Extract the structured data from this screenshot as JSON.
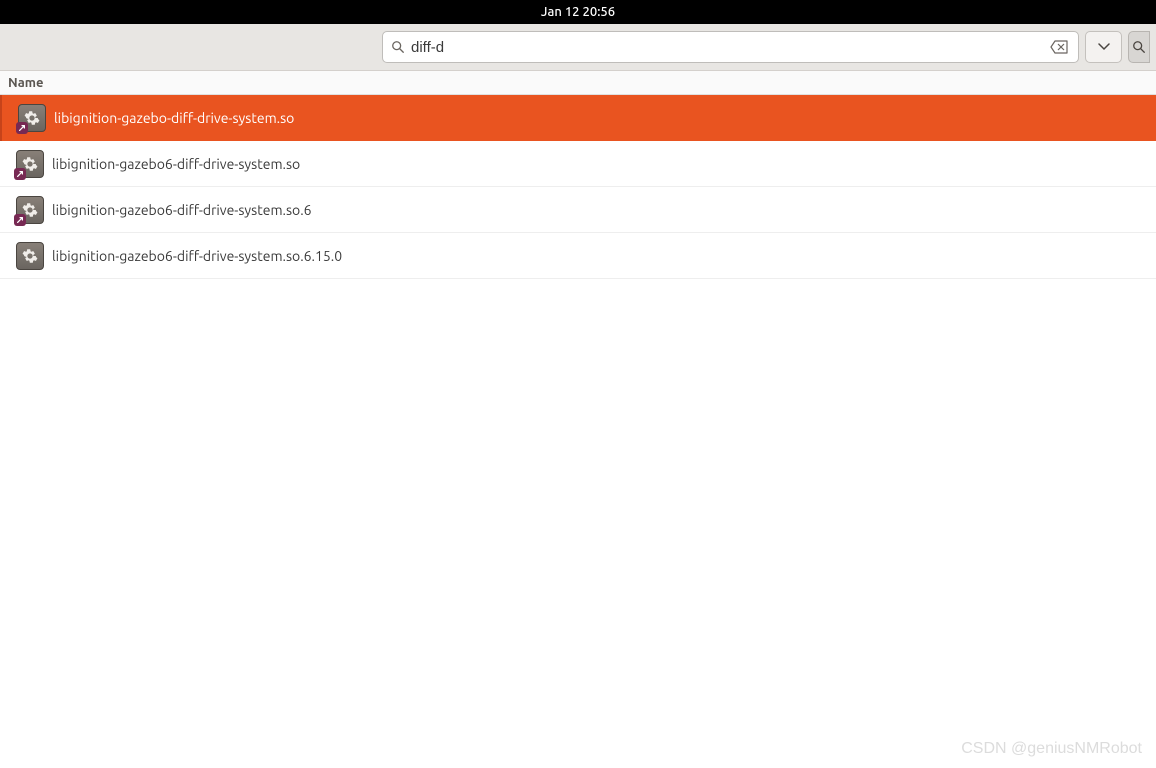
{
  "topbar": {
    "datetime": "Jan 12  20:56"
  },
  "search": {
    "value": "diff-d",
    "placeholder": ""
  },
  "columns": {
    "name": "Name"
  },
  "files": [
    {
      "name": "libignition-gazebo-diff-drive-system.so",
      "selected": true,
      "symlink": true
    },
    {
      "name": "libignition-gazebo6-diff-drive-system.so",
      "selected": false,
      "symlink": true
    },
    {
      "name": "libignition-gazebo6-diff-drive-system.so.6",
      "selected": false,
      "symlink": true
    },
    {
      "name": "libignition-gazebo6-diff-drive-system.so.6.15.0",
      "selected": false,
      "symlink": false
    }
  ],
  "watermark": "CSDN @geniusNMRobot",
  "colors": {
    "selection": "#e95420",
    "ubuntu_purple": "#772953"
  }
}
